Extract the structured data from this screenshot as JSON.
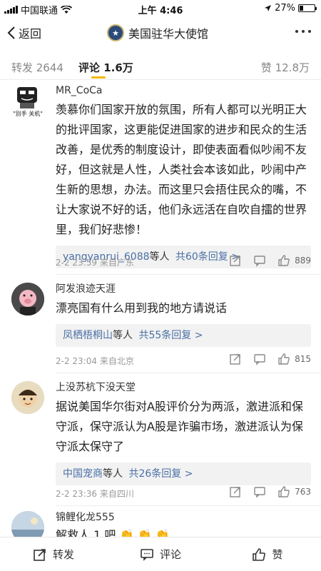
{
  "status_bar": {
    "carrier": "中国联通",
    "time": "上午 4:46",
    "battery": "27%",
    "battery_level": 0.27
  },
  "nav": {
    "back_label": "返回",
    "title": "美国驻华大使馆"
  },
  "tabs": {
    "repost": "转发 2644",
    "comment": "评论 1.6万",
    "like": "赞 12.8万",
    "accent_color": "#f7b500"
  },
  "comments": [
    {
      "username": "MR_CoCa",
      "avatar_caption": "\"别手 关机\"",
      "text": "羡慕你们国家开放的氛围，所有人都可以光明正大的批评国家，这更能促进国家的进步和民众的生活改善，是优秀的制度设计，即使表面看似吵闹不友好，但这就是人性，人类社会本该如此，吵闹中产生新的思想，办法。而这里只会捂住民众的嘴，不让大家说不好的话，他们永远活在自吹自擂的世界里，我们好悲惨！",
      "reply_user": "yangyanrui_6088",
      "reply_suffix": "等人",
      "reply_total": "共60条回复 >",
      "time": "2-2 23:59",
      "source": "来自广东",
      "likes": "889"
    },
    {
      "username": "阿发浪迹天涯",
      "text": "漂亮国有什么用到我的地方请说话",
      "reply_user": "凤栖梧桐山",
      "reply_suffix": "等人",
      "reply_total": "共55条回复 >",
      "time": "2-2 23:04",
      "source": "来自北京",
      "likes": "815"
    },
    {
      "username": "上没苏杭下没天堂",
      "text": "据说美国华尔街对A股评价分为两派，激进派和保守派，保守派认为A股是诈骗市场，激进派认为保守派太保守了",
      "reply_user": "中国宠商",
      "reply_suffix": "等人",
      "reply_total": "共26条回复 >",
      "time": "2-2 23:36",
      "source": "来自四川",
      "likes": "763"
    },
    {
      "username": "锦鲤化龙555",
      "text": "解救人 1 吧 👏 👏 👏"
    }
  ],
  "bottom_bar": {
    "repost": "转发",
    "comment": "评论",
    "like": "赞"
  },
  "colors": {
    "link": "#4a6fa5",
    "meta": "#999999"
  }
}
